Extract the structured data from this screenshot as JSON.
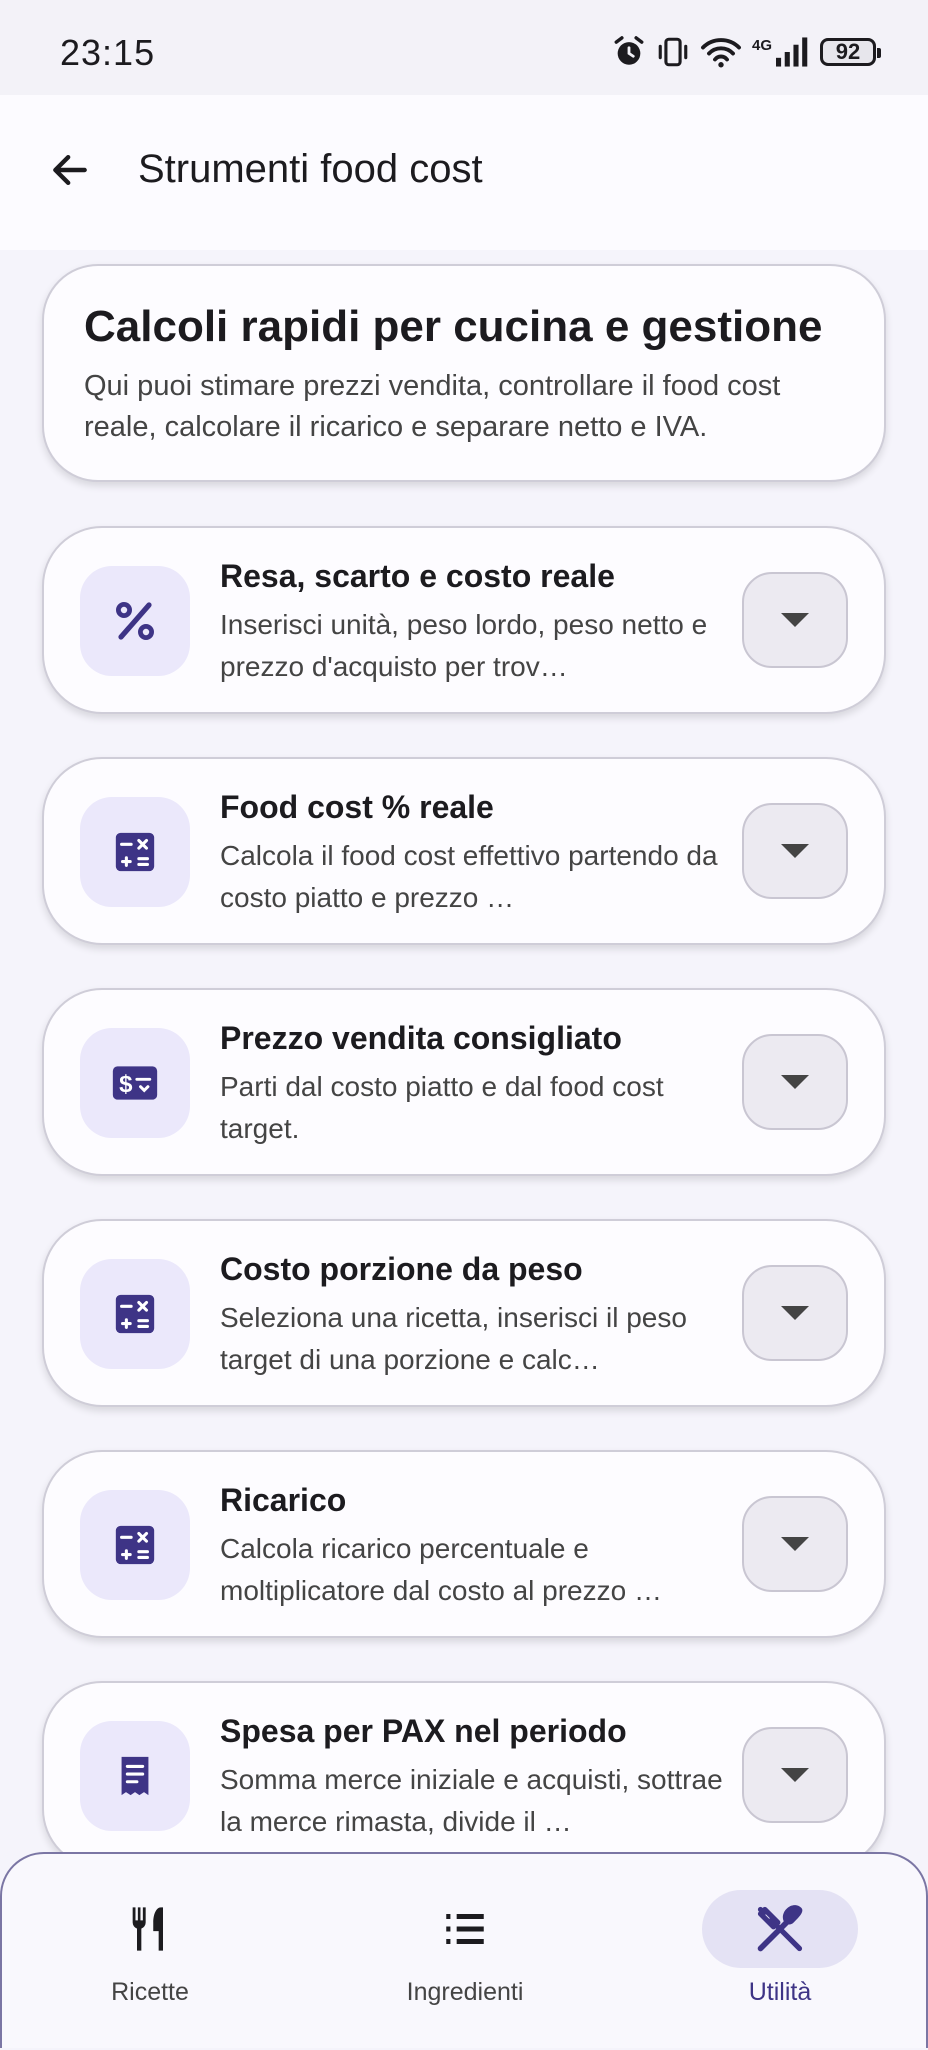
{
  "status_bar": {
    "time": "23:15",
    "battery": "92",
    "network": "4G",
    "icons": [
      "alarm-icon",
      "vibrate-icon",
      "wifi-icon",
      "signal-icon",
      "battery-icon"
    ]
  },
  "app_bar": {
    "title": "Strumenti food cost",
    "back_icon": "arrow-left-icon"
  },
  "intro": {
    "title": "Calcoli rapidi per cucina e gestione",
    "text": "Qui puoi stimare prezzi vendita, controllare il food cost reale, calcolare il ricarico e separare netto e IVA."
  },
  "tools": [
    {
      "title": "Resa, scarto e costo reale",
      "desc": "Inserisci unità, peso lordo, peso netto e prezzo d'acquisto per trov…",
      "icon": "percent-icon"
    },
    {
      "title": "Food cost % reale",
      "desc": "Calcola il food cost effettivo partendo da costo piatto e prezzo …",
      "icon": "calculator-icon"
    },
    {
      "title": "Prezzo vendita consigliato",
      "desc": "Parti dal costo piatto e dal food cost target.",
      "icon": "price-tag-icon"
    },
    {
      "title": "Costo porzione da peso",
      "desc": "Seleziona una ricetta, inserisci il peso target di una porzione e calc…",
      "icon": "calculator-icon"
    },
    {
      "title": "Ricarico",
      "desc": "Calcola ricarico percentuale e moltiplicatore dal costo al prezzo …",
      "icon": "calculator-icon"
    },
    {
      "title": "Spesa per PAX nel periodo",
      "desc": "Somma merce iniziale e acquisti, sottrae la merce rimasta, divide il …",
      "icon": "receipt-icon"
    }
  ],
  "bottom_nav": [
    {
      "label": "Ricette",
      "icon": "fork-knife-icon",
      "active": false
    },
    {
      "label": "Ingredienti",
      "icon": "list-icon",
      "active": false
    },
    {
      "label": "Utilità",
      "icon": "utensils-cross-icon",
      "active": true
    }
  ],
  "colors": {
    "accent": "#3e3486",
    "icon_bg": "#ebe8fb",
    "card_bg": "#fdfcff",
    "page_bg": "#f5f4fb"
  }
}
